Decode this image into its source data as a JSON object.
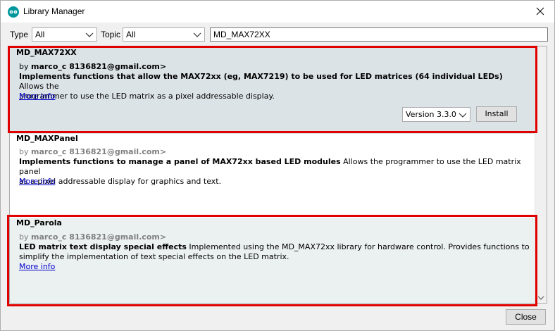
{
  "window": {
    "title": "Library Manager",
    "icon": "arduino-logo-icon",
    "accent_color": "#00979c"
  },
  "filters": {
    "type_label": "Type",
    "type_value": "All",
    "topic_label": "Topic",
    "topic_value": "All",
    "search_value": "MD_MAX72XX"
  },
  "libraries": [
    {
      "name": "MD_MAX72XX",
      "by_prefix": "by ",
      "author": "marco_c 8136821@gmail.com>",
      "summary": "Implements functions that allow the MAX72xx (eg, MAX7219) to be used for LED matrices (64 individual LEDs)",
      "details_line1": " Allows the",
      "details_line2": "programmer to use the LED matrix as a pixel addressable display.",
      "more_info": "More info",
      "version_label": "Version 3.3.0",
      "install_label": "Install"
    },
    {
      "name": "MD_MAXPanel",
      "by_prefix": "by ",
      "author": "marco_c 8136821@gmail.com>",
      "summary": "Implements functions to manage a panel of MAX72xx based LED modules",
      "details_line1": " Allows the programmer to use the LED matrix panel",
      "details_line2": "as a pixel addressable display for graphics and text.",
      "more_info": "More info"
    },
    {
      "name": "MD_Parola",
      "by_prefix": "by ",
      "author": "marco_c 8136821@gmail.com>",
      "summary": "LED matrix text display special effects",
      "details_line1": " Implemented using the MD_MAX72xx library for hardware control. Provides functions to",
      "details_line2": "simplify the implementation of text special effects on the LED matrix.",
      "more_info": "More info"
    }
  ],
  "footer": {
    "close_label": "Close"
  },
  "highlight_color": "#e00000"
}
